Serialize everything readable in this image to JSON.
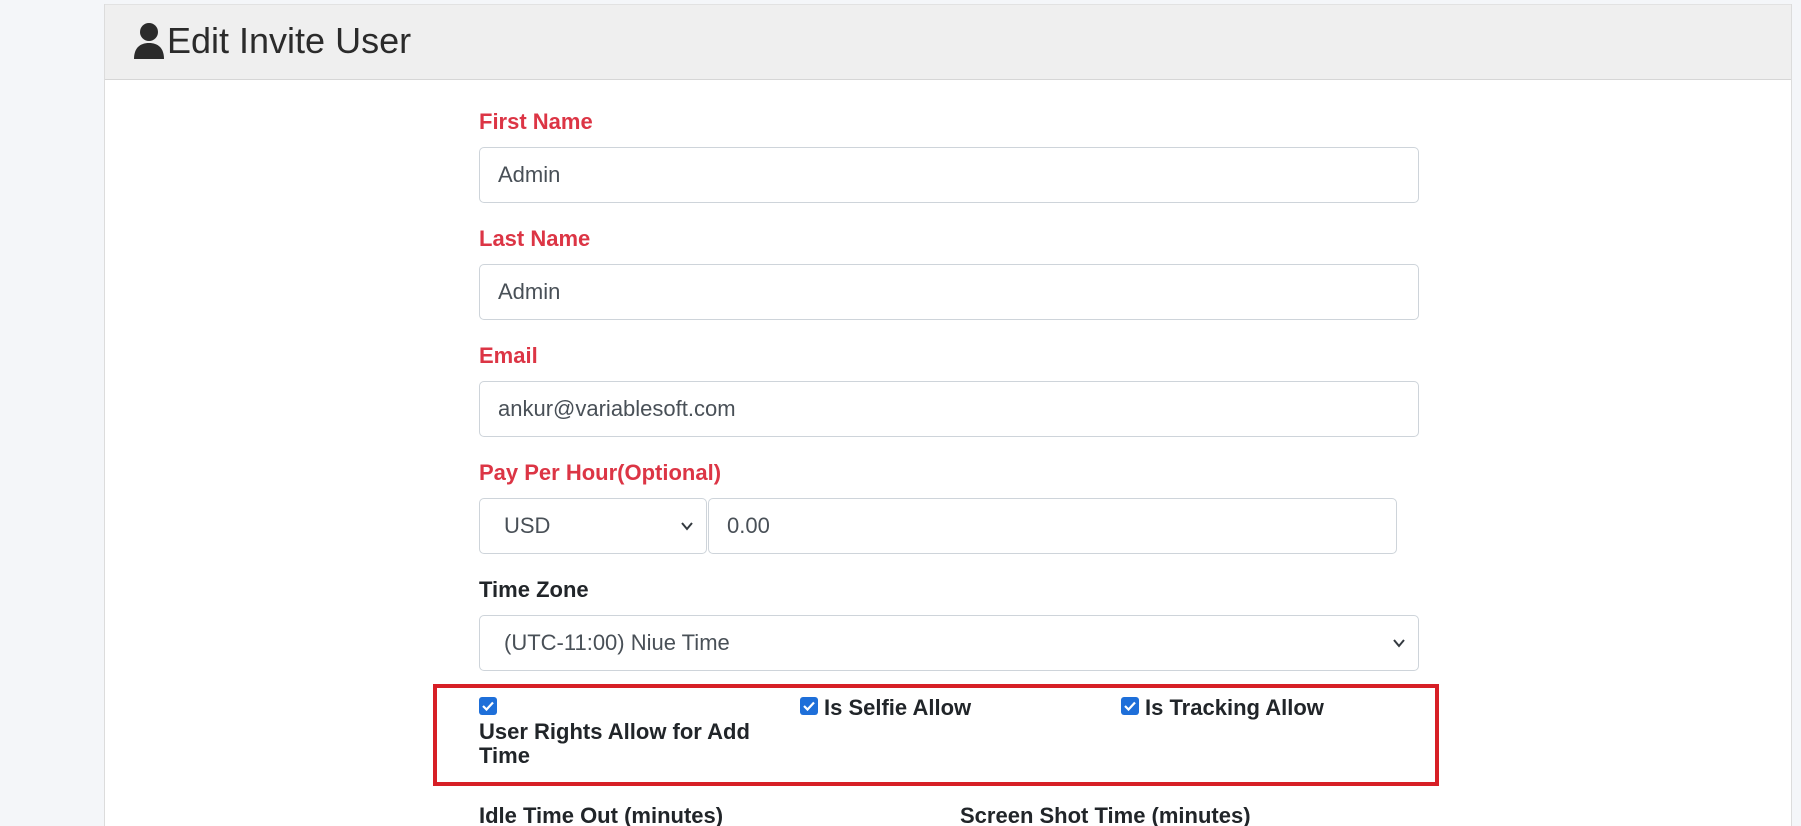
{
  "header": {
    "title": "Edit Invite User",
    "icon": "user-icon"
  },
  "form": {
    "first_name": {
      "label": "First Name",
      "value": "Admin"
    },
    "last_name": {
      "label": "Last Name",
      "value": "Admin"
    },
    "email": {
      "label": "Email",
      "value": "ankur@variablesoft.com"
    },
    "pay_per_hour": {
      "label": "Pay Per Hour(Optional)",
      "currency": "USD",
      "amount": "0.00"
    },
    "time_zone": {
      "label": "Time Zone",
      "value": "(UTC-11:00) Niue Time"
    },
    "checkboxes": [
      {
        "label": "User Rights Allow for Add Time",
        "checked": true
      },
      {
        "label": "Is Selfie Allow",
        "checked": true
      },
      {
        "label": "Is Tracking Allow",
        "checked": true
      }
    ],
    "idle_time_out": {
      "label": "Idle Time Out (minutes)"
    },
    "screen_shot_time": {
      "label": "Screen Shot Time (minutes)"
    }
  },
  "colors": {
    "required_label": "#dc3545",
    "checkbox": "#1e6fd9",
    "highlight": "#d71f26"
  }
}
